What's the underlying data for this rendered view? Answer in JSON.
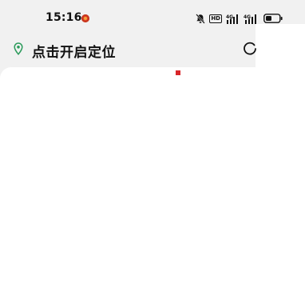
{
  "status_bar": {
    "time": "15:16",
    "icons": [
      "app-notification-icon",
      "mute-icon",
      "hd-icon",
      "4g-signal-icon",
      "4g-signal-icon",
      "battery-icon"
    ],
    "hd_label": "HD",
    "network_label": "4G"
  },
  "location": {
    "label": "点击开启定位",
    "icon": "location-pin-icon",
    "refresh_icon": "refresh-icon"
  },
  "colors": {
    "background": "#f1f1f1",
    "card": "#ffffff",
    "marker": "#d8262a",
    "pin": "#2a9a5a"
  }
}
